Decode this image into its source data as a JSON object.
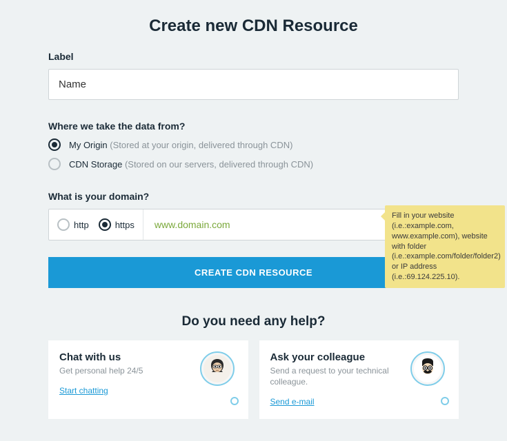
{
  "title": "Create new CDN Resource",
  "label_field": {
    "label": "Label",
    "value": "Name"
  },
  "origin": {
    "question": "Where we take the data from?",
    "options": [
      {
        "name": "My Origin",
        "desc": "(Stored at your origin, delivered through CDN)",
        "selected": true
      },
      {
        "name": "CDN Storage",
        "desc": "(Stored on our servers, delivered through CDN)",
        "selected": false
      }
    ]
  },
  "domain": {
    "question": "What is your domain?",
    "protocols": [
      {
        "label": "http",
        "selected": false
      },
      {
        "label": "https",
        "selected": true
      }
    ],
    "value": "www.domain.com"
  },
  "tooltip": "Fill in your website (i.e.:example.com, www.example.com), website with folder (i.e.:example.com/folder/folder2) or IP address (i.e.:69.124.225.10).",
  "cta": "CREATE CDN RESOURCE",
  "help": {
    "title": "Do you need any help?",
    "cards": [
      {
        "title": "Chat with us",
        "subtitle": "Get personal help 24/5",
        "link": "Start chatting"
      },
      {
        "title": "Ask your colleague",
        "subtitle": "Send a request to your technical colleague.",
        "link": "Send e-mail"
      }
    ]
  }
}
